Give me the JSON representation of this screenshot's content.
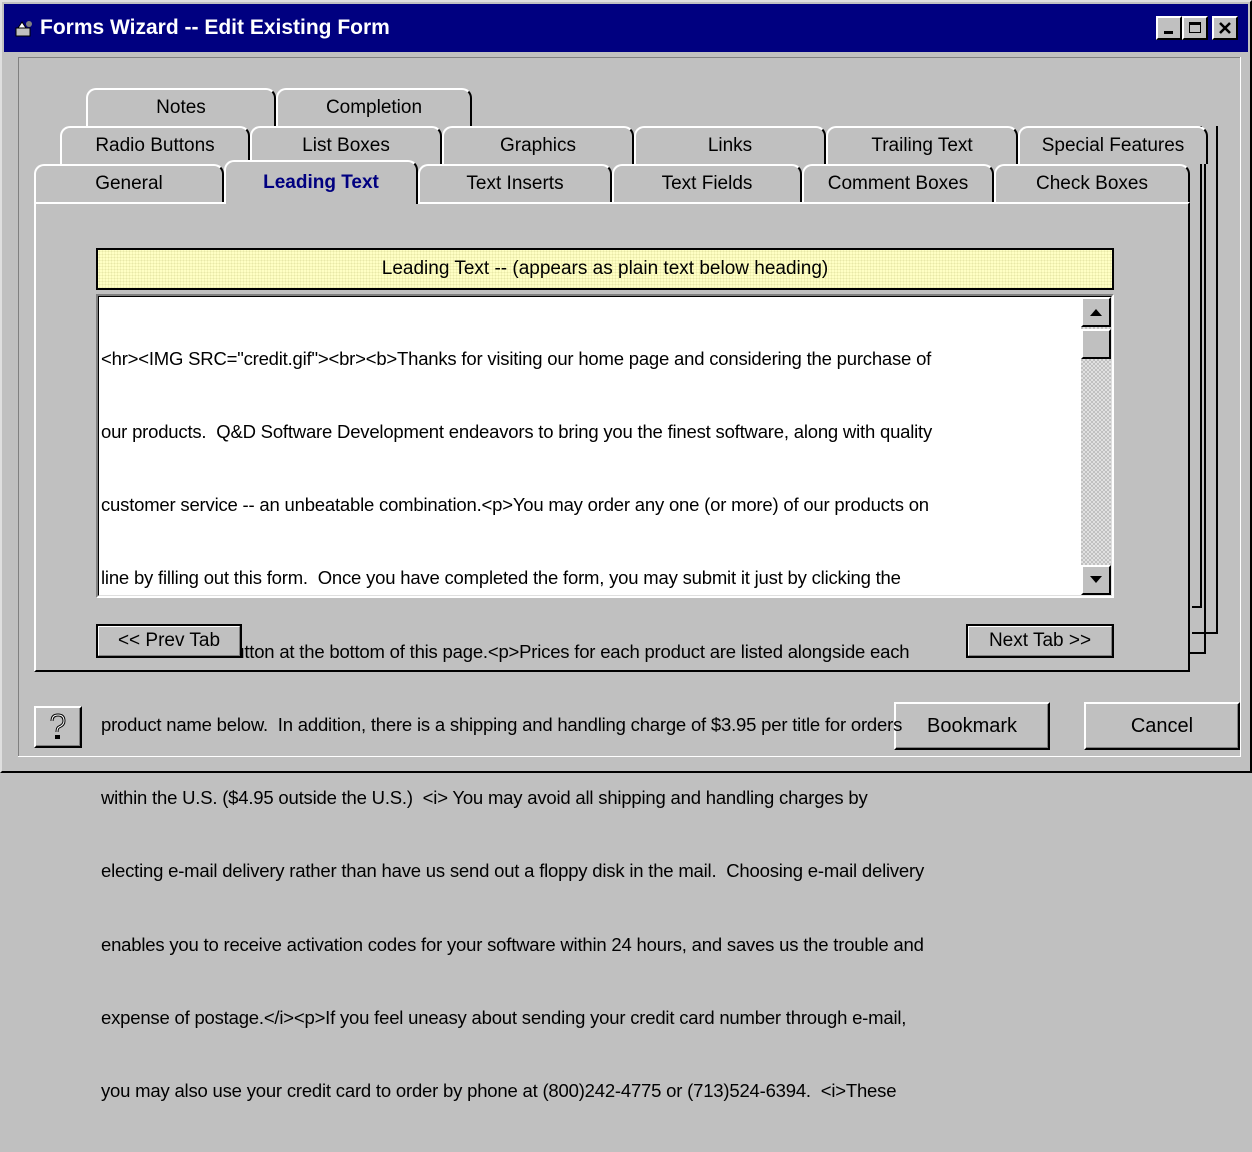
{
  "window": {
    "title": "Forms Wizard -- Edit Existing Form",
    "icons": {
      "app": "wizard-app-icon",
      "minimize": "minimize-icon",
      "maximize": "maximize-icon",
      "close": "close-icon"
    }
  },
  "tabs": {
    "row1": [
      {
        "label": "Notes"
      },
      {
        "label": "Completion"
      }
    ],
    "row2": [
      {
        "label": "Radio Buttons"
      },
      {
        "label": "List Boxes"
      },
      {
        "label": "Graphics"
      },
      {
        "label": "Links"
      },
      {
        "label": "Trailing Text"
      },
      {
        "label": "Special Features"
      }
    ],
    "row3": [
      {
        "label": "General"
      },
      {
        "label": "Leading Text",
        "active": true
      },
      {
        "label": "Text Inserts"
      },
      {
        "label": "Text Fields"
      },
      {
        "label": "Comment Boxes"
      },
      {
        "label": "Check Boxes"
      }
    ]
  },
  "panel": {
    "heading": "Leading Text -- (appears as plain text below heading)",
    "text_value": "<hr><IMG SRC=\"credit.gif\"><br><b>Thanks for visiting our home page and considering the purchase of our products.  Q&D Software Development endeavors to bring you the finest software, along with quality customer service -- an unbeatable combination.<p>You may order any one (or more) of our products on line by filling out this form.  Once you have completed the form, you may submit it just by clicking the <i>'Submit'</i> button at the bottom of this page.<p>Prices for each product are listed alongside each product name below.  In addition, there is a shipping and handling charge of $3.95 per title for orders within the U.S. ($4.95 outside the U.S.)  <i> You may avoid all shipping and handling charges by electing e-mail delivery rather than have us send out a floppy disk in the mail.  Choosing e-mail delivery enables you to receive activation codes for your software within 24 hours, and saves us the trouble and expense of postage.</i><p>If you feel uneasy about sending your credit card number through e-mail, you may also use your credit card to order by phone at (800)242-4775 or (713)524-6394.  <i>These",
    "text_lines": [
      "<hr><IMG SRC=\"credit.gif\"><br><b>Thanks for visiting our home page and considering the purchase of",
      "our products.  Q&D Software Development endeavors to bring you the finest software, along with quality",
      "customer service -- an unbeatable combination.<p>You may order any one (or more) of our products on",
      "line by filling out this form.  Once you have completed the form, you may submit it just by clicking the",
      "<i>'Submit'</i> button at the bottom of this page.<p>Prices for each product are listed alongside each",
      "product name below.  In addition, there is a shipping and handling charge of $3.95 per title for orders",
      "within the U.S. ($4.95 outside the U.S.)  <i> You may avoid all shipping and handling charges by",
      "electing e-mail delivery rather than have us send out a floppy disk in the mail.  Choosing e-mail delivery",
      "enables you to receive activation codes for your software within 24 hours, and saves us the trouble and",
      "expense of postage.</i><p>If you feel uneasy about sending your credit card number through e-mail,",
      "you may also use your credit card to order by phone at (800)242-4775 or (713)524-6394.  <i>These"
    ],
    "prev_label": "<< Prev Tab",
    "next_label": "Next Tab >>"
  },
  "footer": {
    "help_icon": "help-question-icon",
    "bookmark_label": "Bookmark",
    "cancel_label": "Cancel"
  },
  "colors": {
    "titlebar": "#000080",
    "active_tab_text": "#000080",
    "heading_bg": "#ffffc4",
    "face": "#c0c0c0"
  }
}
